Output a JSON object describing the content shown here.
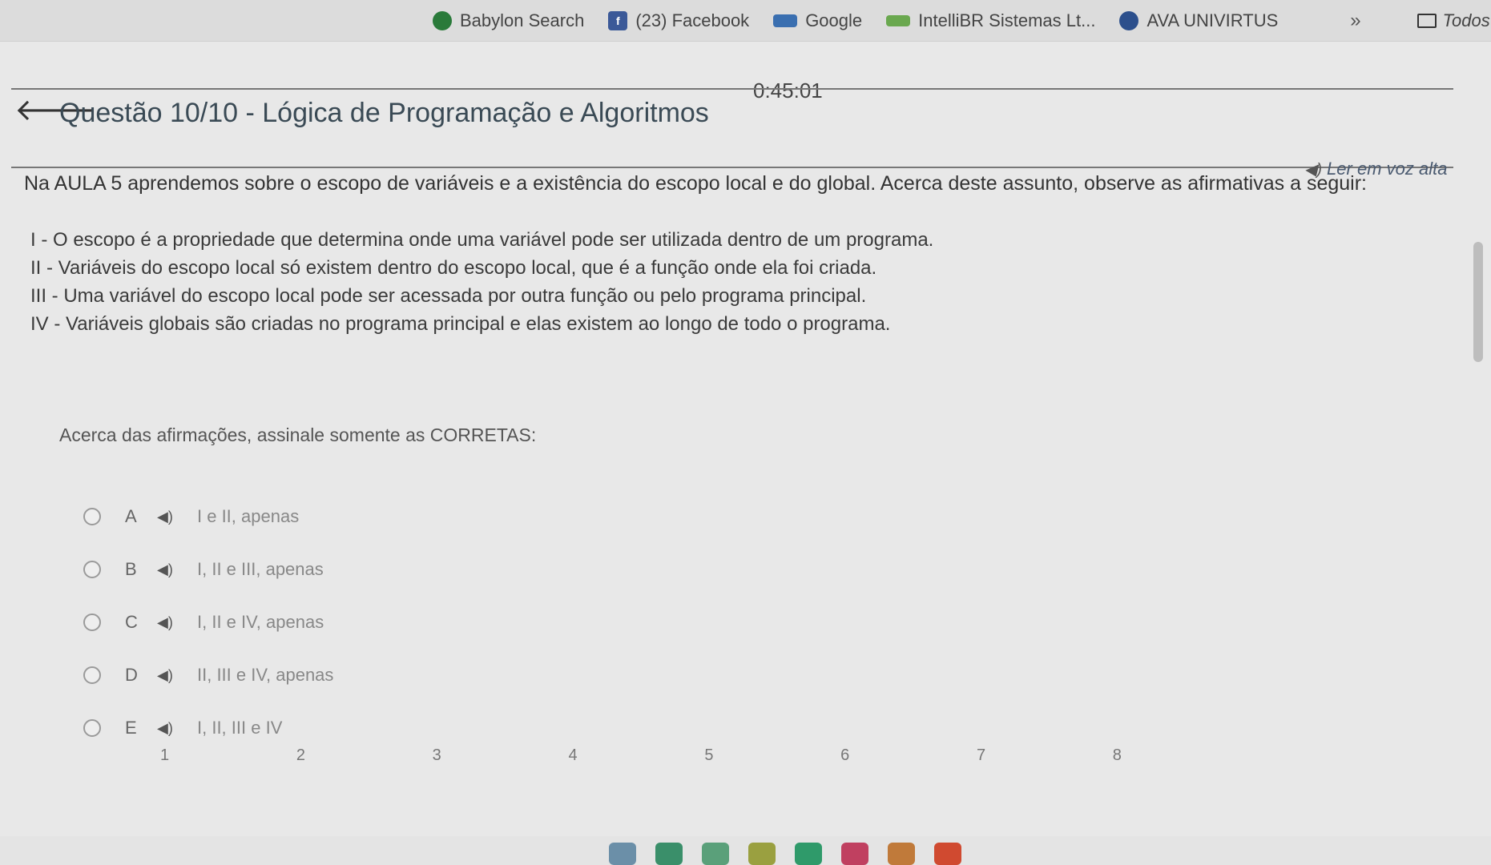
{
  "bookmarks": {
    "items": [
      {
        "label": "Babylon Search",
        "icon": "babylon-icon"
      },
      {
        "label": "(23) Facebook",
        "icon": "facebook-icon"
      },
      {
        "label": "Google",
        "icon": "google-icon"
      },
      {
        "label": "IntelliBR Sistemas Lt...",
        "icon": "intellibr-icon"
      },
      {
        "label": "AVA UNIVIRTUS",
        "icon": "ava-icon"
      }
    ],
    "more": "»",
    "folder_label": "Todos os favor"
  },
  "timer": "0:45:01",
  "question": {
    "title": "Questão 10/10 - Lógica de Programação e Algoritmos",
    "read_aloud": "Ler em voz alta",
    "statement": "Na AULA 5 aprendemos sobre o escopo de variáveis e a existência do escopo local e do global. Acerca deste assunto, observe as afirmativas a seguir:",
    "assertions": [
      "I - O escopo é a propriedade que determina onde uma variável pode ser utilizada dentro de um programa.",
      "II - Variáveis do escopo local só existem dentro do escopo local, que é a função onde ela foi criada.",
      "III - Uma variável do escopo local pode ser acessada por outra função ou pelo programa principal.",
      "IV - Variáveis globais são criadas no programa principal e elas existem ao longo de todo o programa."
    ],
    "ask": "Acerca das afirmações, assinale somente as CORRETAS:",
    "options": [
      {
        "letter": "A",
        "text": "I e II, apenas"
      },
      {
        "letter": "B",
        "text": "I, II e III, apenas"
      },
      {
        "letter": "C",
        "text": "I, II e IV, apenas"
      },
      {
        "letter": "D",
        "text": "II, III e IV, apenas"
      },
      {
        "letter": "E",
        "text": "I, II, III e IV"
      }
    ]
  },
  "pager": [
    "1",
    "2",
    "3",
    "4",
    "5",
    "6",
    "7",
    "8"
  ],
  "colors": {
    "facebook": "#3b5998",
    "title": "#3a4a55"
  }
}
